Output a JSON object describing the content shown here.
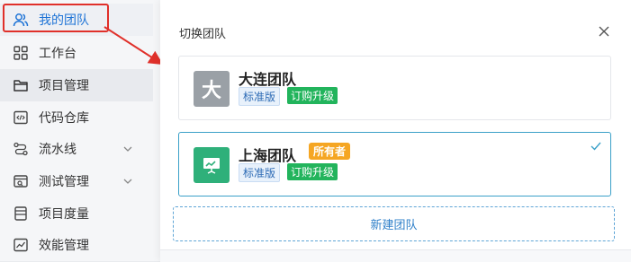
{
  "sidebar": {
    "items": [
      {
        "label": "我的团队",
        "icon": "users-icon"
      },
      {
        "label": "工作台",
        "icon": "grid-icon"
      },
      {
        "label": "项目管理",
        "icon": "folder-icon"
      },
      {
        "label": "代码仓库",
        "icon": "code-icon"
      },
      {
        "label": "流水线",
        "icon": "pipeline-icon"
      },
      {
        "label": "测试管理",
        "icon": "test-icon"
      },
      {
        "label": "项目度量",
        "icon": "measure-icon"
      },
      {
        "label": "效能管理",
        "icon": "chart-icon"
      }
    ]
  },
  "panel": {
    "title": "切换团队",
    "teams": [
      {
        "name": "大连团队",
        "avatar_text": "大",
        "edition": "标准版",
        "upgrade": "订购升级"
      },
      {
        "name": "上海团队",
        "owner_badge": "所有者",
        "edition": "标准版",
        "upgrade": "订购升级"
      }
    ],
    "new_team_label": "新建团队"
  },
  "colors": {
    "accent": "#1f74d6",
    "annotation_red": "#e0302a",
    "upgrade_green": "#22b45c",
    "owner_orange": "#f5a623"
  }
}
